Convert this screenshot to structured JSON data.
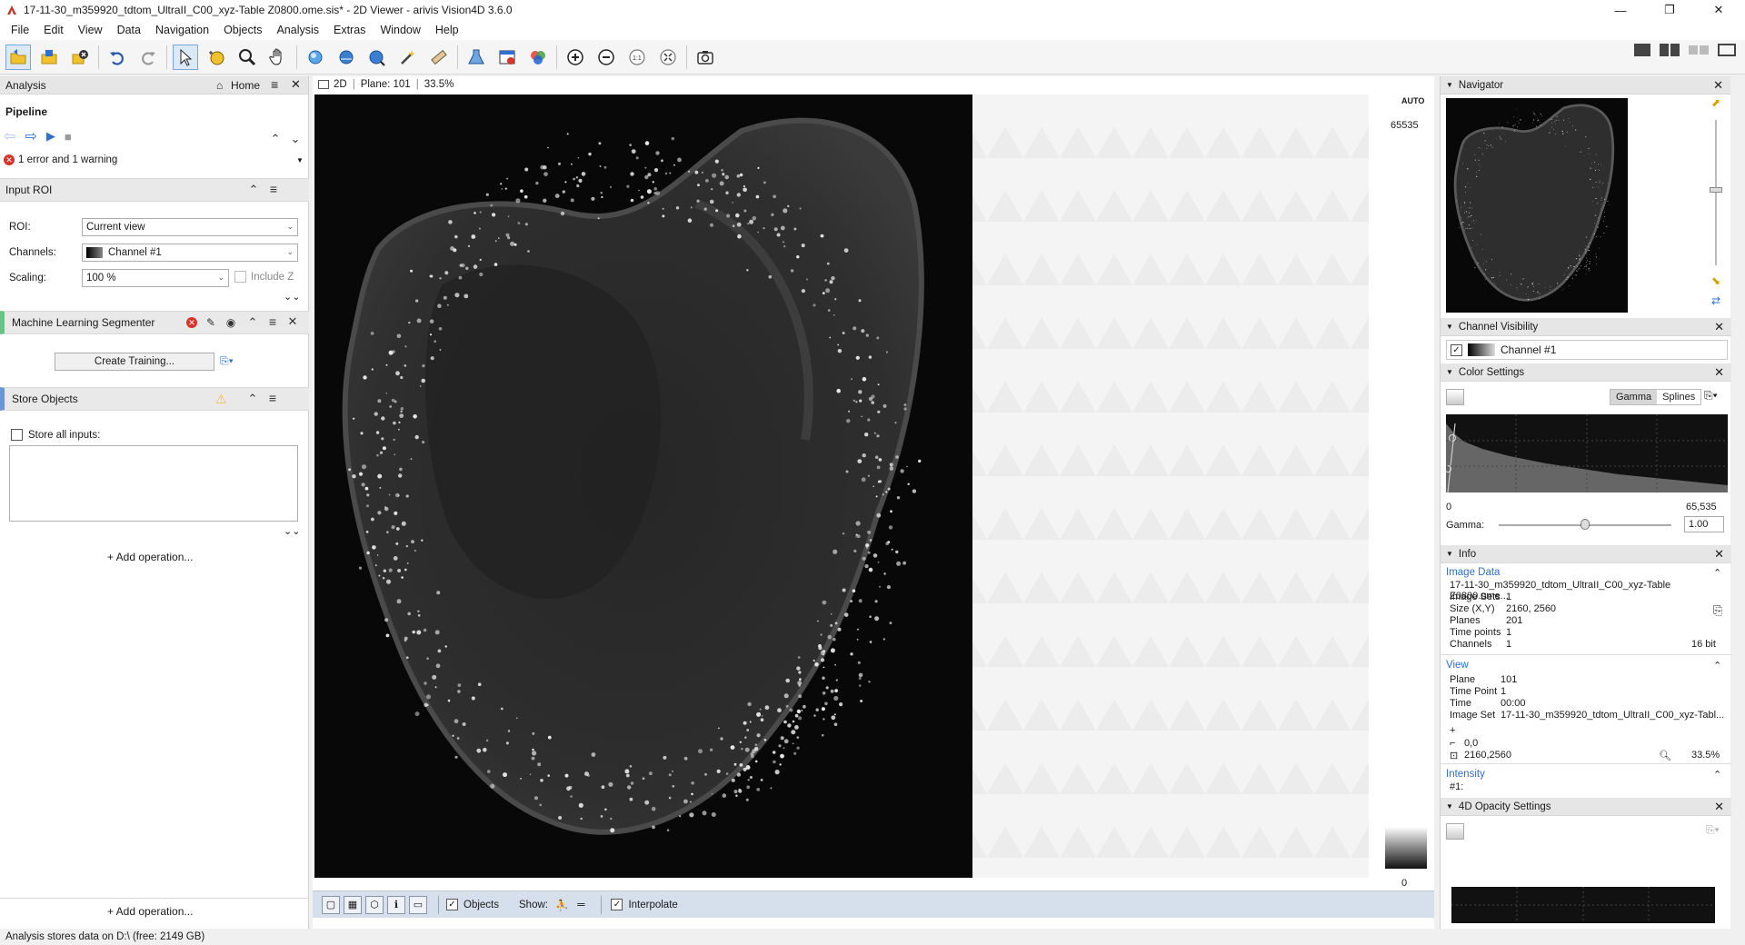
{
  "window": {
    "title": "17-11-30_m359920_tdtom_UltraII_C00_xyz-Table Z0800.ome.sis* - 2D Viewer - arivis Vision4D 3.6.0",
    "min": "—",
    "restore": "❐",
    "close": "✕"
  },
  "menu": [
    "File",
    "Edit",
    "View",
    "Data",
    "Navigation",
    "Objects",
    "Analysis",
    "Extras",
    "Window",
    "Help"
  ],
  "analysis": {
    "panel_title": "Analysis",
    "home_label": "Home",
    "pipeline_label": "Pipeline",
    "errors_text": "1 error and 1 warning",
    "input_roi": {
      "title": "Input ROI",
      "roi_label": "ROI:",
      "roi_value": "Current view",
      "channels_label": "Channels:",
      "channels_value": "Channel #1",
      "scaling_label": "Scaling:",
      "scaling_value": "100 %",
      "include_z_label": "Include Z"
    },
    "ml_segmenter": {
      "title": "Machine Learning Segmenter",
      "create_training_label": "Create Training..."
    },
    "store_objects": {
      "title": "Store Objects",
      "store_all_label": "Store all inputs:"
    },
    "add_operation_label": "+ Add operation...",
    "add_operation_bottom_label": "+ Add operation..."
  },
  "viewer": {
    "mode": "2D",
    "plane_label": "Plane: 101",
    "zoom_label": "33.5%",
    "auto_label": "AUTO",
    "max_value": "65535",
    "min_value": "0",
    "bottom": {
      "objects_label": "Objects",
      "show_label": "Show:",
      "interpolate_label": "Interpolate"
    }
  },
  "navigator": {
    "title": "Navigator"
  },
  "channel_visibility": {
    "title": "Channel Visibility",
    "channel_name": "Channel #1"
  },
  "color_settings": {
    "title": "Color Settings",
    "gamma_tab": "Gamma",
    "splines_tab": "Splines",
    "axis_min": "0",
    "axis_max": "65,535",
    "gamma_label": "Gamma:",
    "gamma_value": "1.00",
    "gamma_slider_fraction": 0.5
  },
  "info": {
    "title": "Info",
    "image_data_label": "Image Data",
    "file_name": "17-11-30_m359920_tdtom_UltraII_C00_xyz-Table Z0800.ome...",
    "image_sets_label": "Image Sets",
    "image_sets_value": "1",
    "size_label": "Size (X,Y)",
    "size_value": "2160, 2560",
    "planes_label": "Planes",
    "planes_value": "201",
    "time_points_label": "Time points",
    "time_points_value": "1",
    "channels_label": "Channels",
    "channels_value": "1",
    "bit_depth": "16 bit",
    "view_label": "View",
    "plane_label": "Plane",
    "plane_value": "101",
    "time_point_label": "Time Point",
    "time_point_value": "1",
    "time_label": "Time",
    "time_value": "00:00",
    "image_set_label": "Image Set",
    "image_set_value": "17-11-30_m359920_tdtom_UltraII_C00_xyz-Tabl...",
    "origin_value": "0,0",
    "extent_value": "2160,2560",
    "zoom_value": "33.5%",
    "intensity_label": "Intensity",
    "intensity_channel": "#1:"
  },
  "opacity": {
    "title": "4D Opacity Settings"
  },
  "status": {
    "text": "Analysis stores data on D:\\ (free: 2149 GB)"
  },
  "colors": {
    "accent_green": "#6fbf87",
    "accent_blue": "#6a96d6",
    "link_blue": "#2e6fd0",
    "error_red": "#d9342b",
    "warning_yellow": "#f2c12e"
  }
}
